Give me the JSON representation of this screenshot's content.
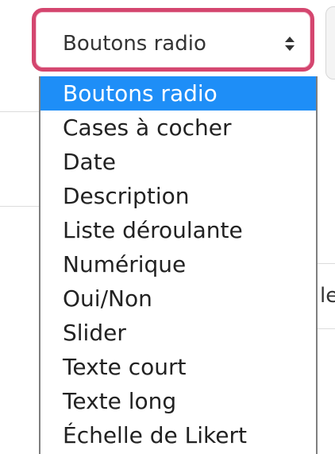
{
  "select": {
    "value": "Boutons radio",
    "options": [
      "Boutons radio",
      "Cases à cocher",
      "Date",
      "Description",
      "Liste déroulante",
      "Numérique",
      "Oui/Non",
      "Slider",
      "Texte court",
      "Texte long",
      "Échelle de Likert"
    ],
    "selected_index": 0
  },
  "background": {
    "fragment": "le"
  },
  "colors": {
    "focus_ring": "#d4466f",
    "highlight": "#1e8ef7"
  },
  "icons": {
    "select_arrows": "up-down-arrows-icon"
  }
}
